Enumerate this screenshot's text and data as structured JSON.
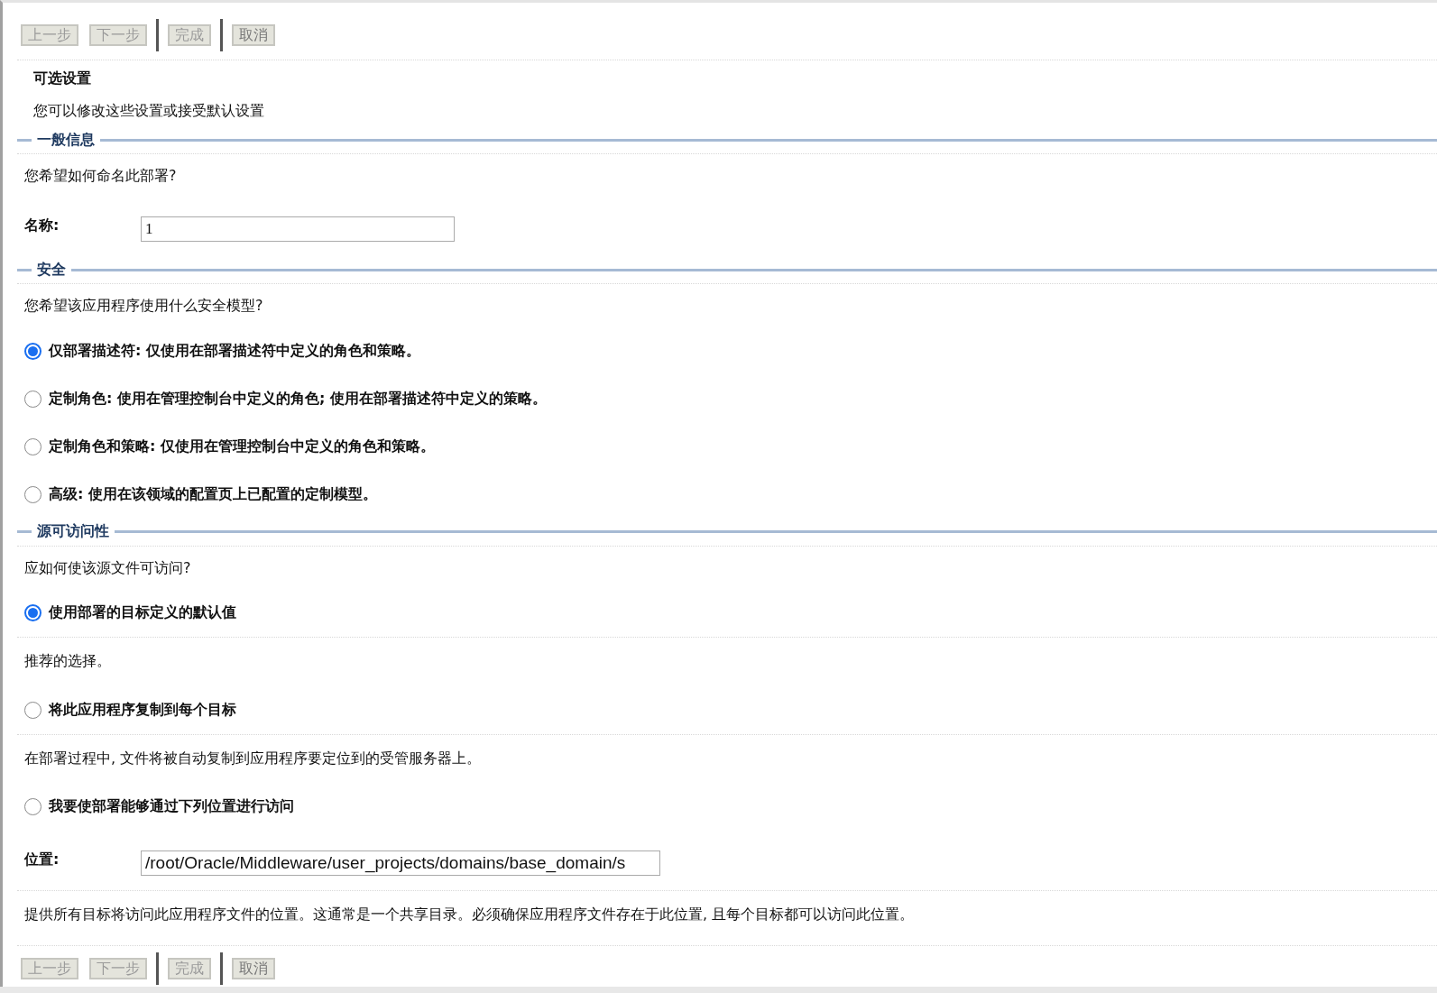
{
  "toolbar_top": {
    "buttons": [
      {
        "label": "上一步",
        "disabled": true,
        "separator_before": false
      },
      {
        "label": "下一步",
        "disabled": true,
        "separator_before": false
      },
      {
        "label": "完成",
        "disabled": true,
        "separator_before": true
      },
      {
        "label": "取消",
        "disabled": false,
        "separator_before": true
      }
    ]
  },
  "title": "可选设置",
  "intro": "您可以修改这些设置或接受默认设置",
  "sections": [
    {
      "title": "一般信息",
      "items": [
        {
          "kind": "question",
          "text": "您希望如何命名此部署?"
        },
        {
          "kind": "field",
          "label": "名称:",
          "value": "1",
          "wide": false
        }
      ]
    },
    {
      "title": "安全",
      "items": [
        {
          "kind": "question",
          "text": "您希望该应用程序使用什么安全模型?"
        },
        {
          "kind": "radio",
          "label": "仅部署描述符: 仅使用在部署描述符中定义的角色和策略。",
          "selected": true,
          "rule_after": false
        },
        {
          "kind": "radio",
          "label": "定制角色: 使用在管理控制台中定义的角色; 使用在部署描述符中定义的策略。",
          "selected": false,
          "rule_after": false
        },
        {
          "kind": "radio",
          "label": "定制角色和策略: 仅使用在管理控制台中定义的角色和策略。",
          "selected": false,
          "rule_after": false
        },
        {
          "kind": "radio",
          "label": "高级: 使用在该领域的配置页上已配置的定制模型。",
          "selected": false,
          "rule_after": false
        }
      ]
    },
    {
      "title": "源可访问性",
      "items": [
        {
          "kind": "question",
          "text": "应如何使该源文件可访问?"
        },
        {
          "kind": "radio",
          "label": "使用部署的目标定义的默认值",
          "selected": true,
          "rule_after": true
        },
        {
          "kind": "note",
          "text": "推荐的选择。"
        },
        {
          "kind": "radio",
          "label": "将此应用程序复制到每个目标",
          "selected": false,
          "rule_after": true
        },
        {
          "kind": "note",
          "text": "在部署过程中, 文件将被自动复制到应用程序要定位到的受管服务器上。"
        },
        {
          "kind": "radio",
          "label": "我要使部署能够通过下列位置进行访问",
          "selected": false,
          "rule_after": false
        },
        {
          "kind": "field",
          "label": "位置:",
          "value": "/root/Oracle/Middleware/user_projects/domains/base_domain/s",
          "wide": true
        },
        {
          "kind": "note",
          "text": "提供所有目标将访问此应用程序文件的位置。这通常是一个共享目录。必须确保应用程序文件存在于此位置, 且每个目标都可以访问此位置。"
        }
      ]
    }
  ],
  "toolbar_bottom": {
    "buttons": [
      {
        "label": "上一步",
        "disabled": true,
        "separator_before": false
      },
      {
        "label": "下一步",
        "disabled": true,
        "separator_before": false
      },
      {
        "label": "完成",
        "disabled": true,
        "separator_before": true
      },
      {
        "label": "取消",
        "disabled": false,
        "separator_before": true
      }
    ]
  }
}
